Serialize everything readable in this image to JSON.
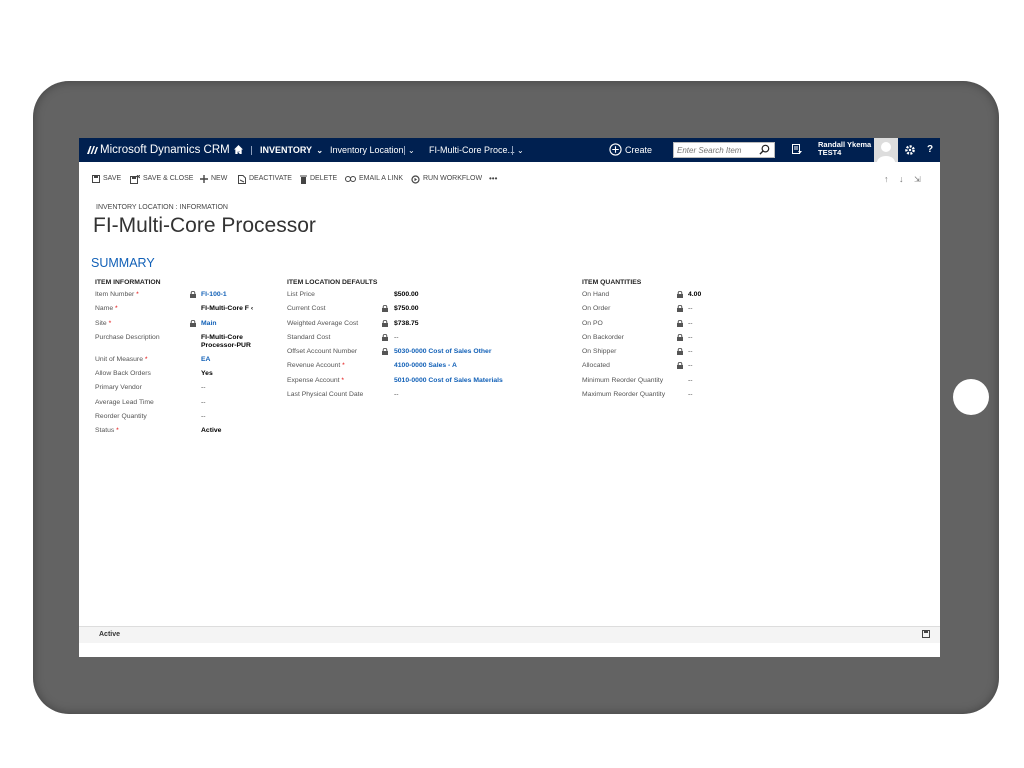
{
  "nav": {
    "brand": "Microsoft Dynamics CRM",
    "module": "INVENTORY",
    "entity": "Inventory Location",
    "record": "FI-Multi-Core Proce...",
    "create_label": "Create",
    "search_placeholder": "Enter Search Item",
    "user_name": "Randall Ykema",
    "user_org": "TEST4",
    "help_label": "?"
  },
  "commands": [
    {
      "label": "SAVE",
      "icon": "save-icon"
    },
    {
      "label": "SAVE & CLOSE",
      "icon": "save-close-icon"
    },
    {
      "label": "NEW",
      "icon": "plus-icon"
    },
    {
      "label": "DEACTIVATE",
      "icon": "deactivate-icon"
    },
    {
      "label": "DELETE",
      "icon": "trash-icon"
    },
    {
      "label": "EMAIL A LINK",
      "icon": "link-icon"
    },
    {
      "label": "RUN WORKFLOW",
      "icon": "workflow-icon"
    },
    {
      "label": "•••",
      "icon": "more-icon"
    }
  ],
  "header": {
    "breadcrumb": "INVENTORY LOCATION : INFORMATION",
    "title": "FI-Multi-Core Processor",
    "section": "SUMMARY"
  },
  "item_information": {
    "heading": "ITEM INFORMATION",
    "fields": [
      {
        "label": "Item Number",
        "required": "*",
        "value": "FI-100-1"
      },
      {
        "label": "Name",
        "required": "*",
        "value": "FI-Multi-Core F ‹"
      },
      {
        "label": "Site",
        "required": "*",
        "value": "Main"
      },
      {
        "label": "Purchase Description",
        "value": "FI-Multi-Core Processor-PUR"
      },
      {
        "label": "Unit of Measure",
        "required": "*",
        "value": "EA"
      },
      {
        "label": "Allow Back Orders",
        "value": "Yes"
      },
      {
        "label": "Primary Vendor",
        "value": "--"
      },
      {
        "label": "Average Lead Time",
        "value": "--"
      },
      {
        "label": "Reorder Quantity",
        "value": "--"
      },
      {
        "label": "Status",
        "required": "*",
        "value": "Active"
      }
    ]
  },
  "location_defaults": {
    "heading": "ITEM LOCATION DEFAULTS",
    "fields": [
      {
        "label": "List Price",
        "value": "$500.00"
      },
      {
        "label": "Current Cost",
        "value": "$750.00"
      },
      {
        "label": "Weighted Average Cost",
        "value": "$738.75"
      },
      {
        "label": "Standard Cost",
        "value": "--"
      },
      {
        "label": "Offset Account Number",
        "value": "5030-0000 Cost of Sales Other"
      },
      {
        "label": "Revenue Account",
        "required": "*",
        "value": "4100-0000 Sales - A"
      },
      {
        "label": "Expense Account",
        "required": "*",
        "value": "5010-0000 Cost of Sales Materials"
      },
      {
        "label": "Last Physical Count Date",
        "value": "--"
      }
    ]
  },
  "quantities": {
    "heading": "ITEM QUANTITIES",
    "fields": [
      {
        "label": "On Hand",
        "value": "4.00"
      },
      {
        "label": "On Order",
        "value": "--"
      },
      {
        "label": "On PO",
        "value": "--"
      },
      {
        "label": "On Backorder",
        "value": "--"
      },
      {
        "label": "On Shipper",
        "value": "--"
      },
      {
        "label": "Allocated",
        "value": "--"
      },
      {
        "label": "Minimum Reorder Quantity",
        "value": "--"
      },
      {
        "label": "Maximum Reorder Quantity",
        "value": "--"
      }
    ]
  },
  "status_bar": {
    "status": "Active"
  },
  "colors": {
    "nav_bg": "#002050",
    "link": "#1160b7",
    "required": "#e00000",
    "tablet": "#636363"
  }
}
